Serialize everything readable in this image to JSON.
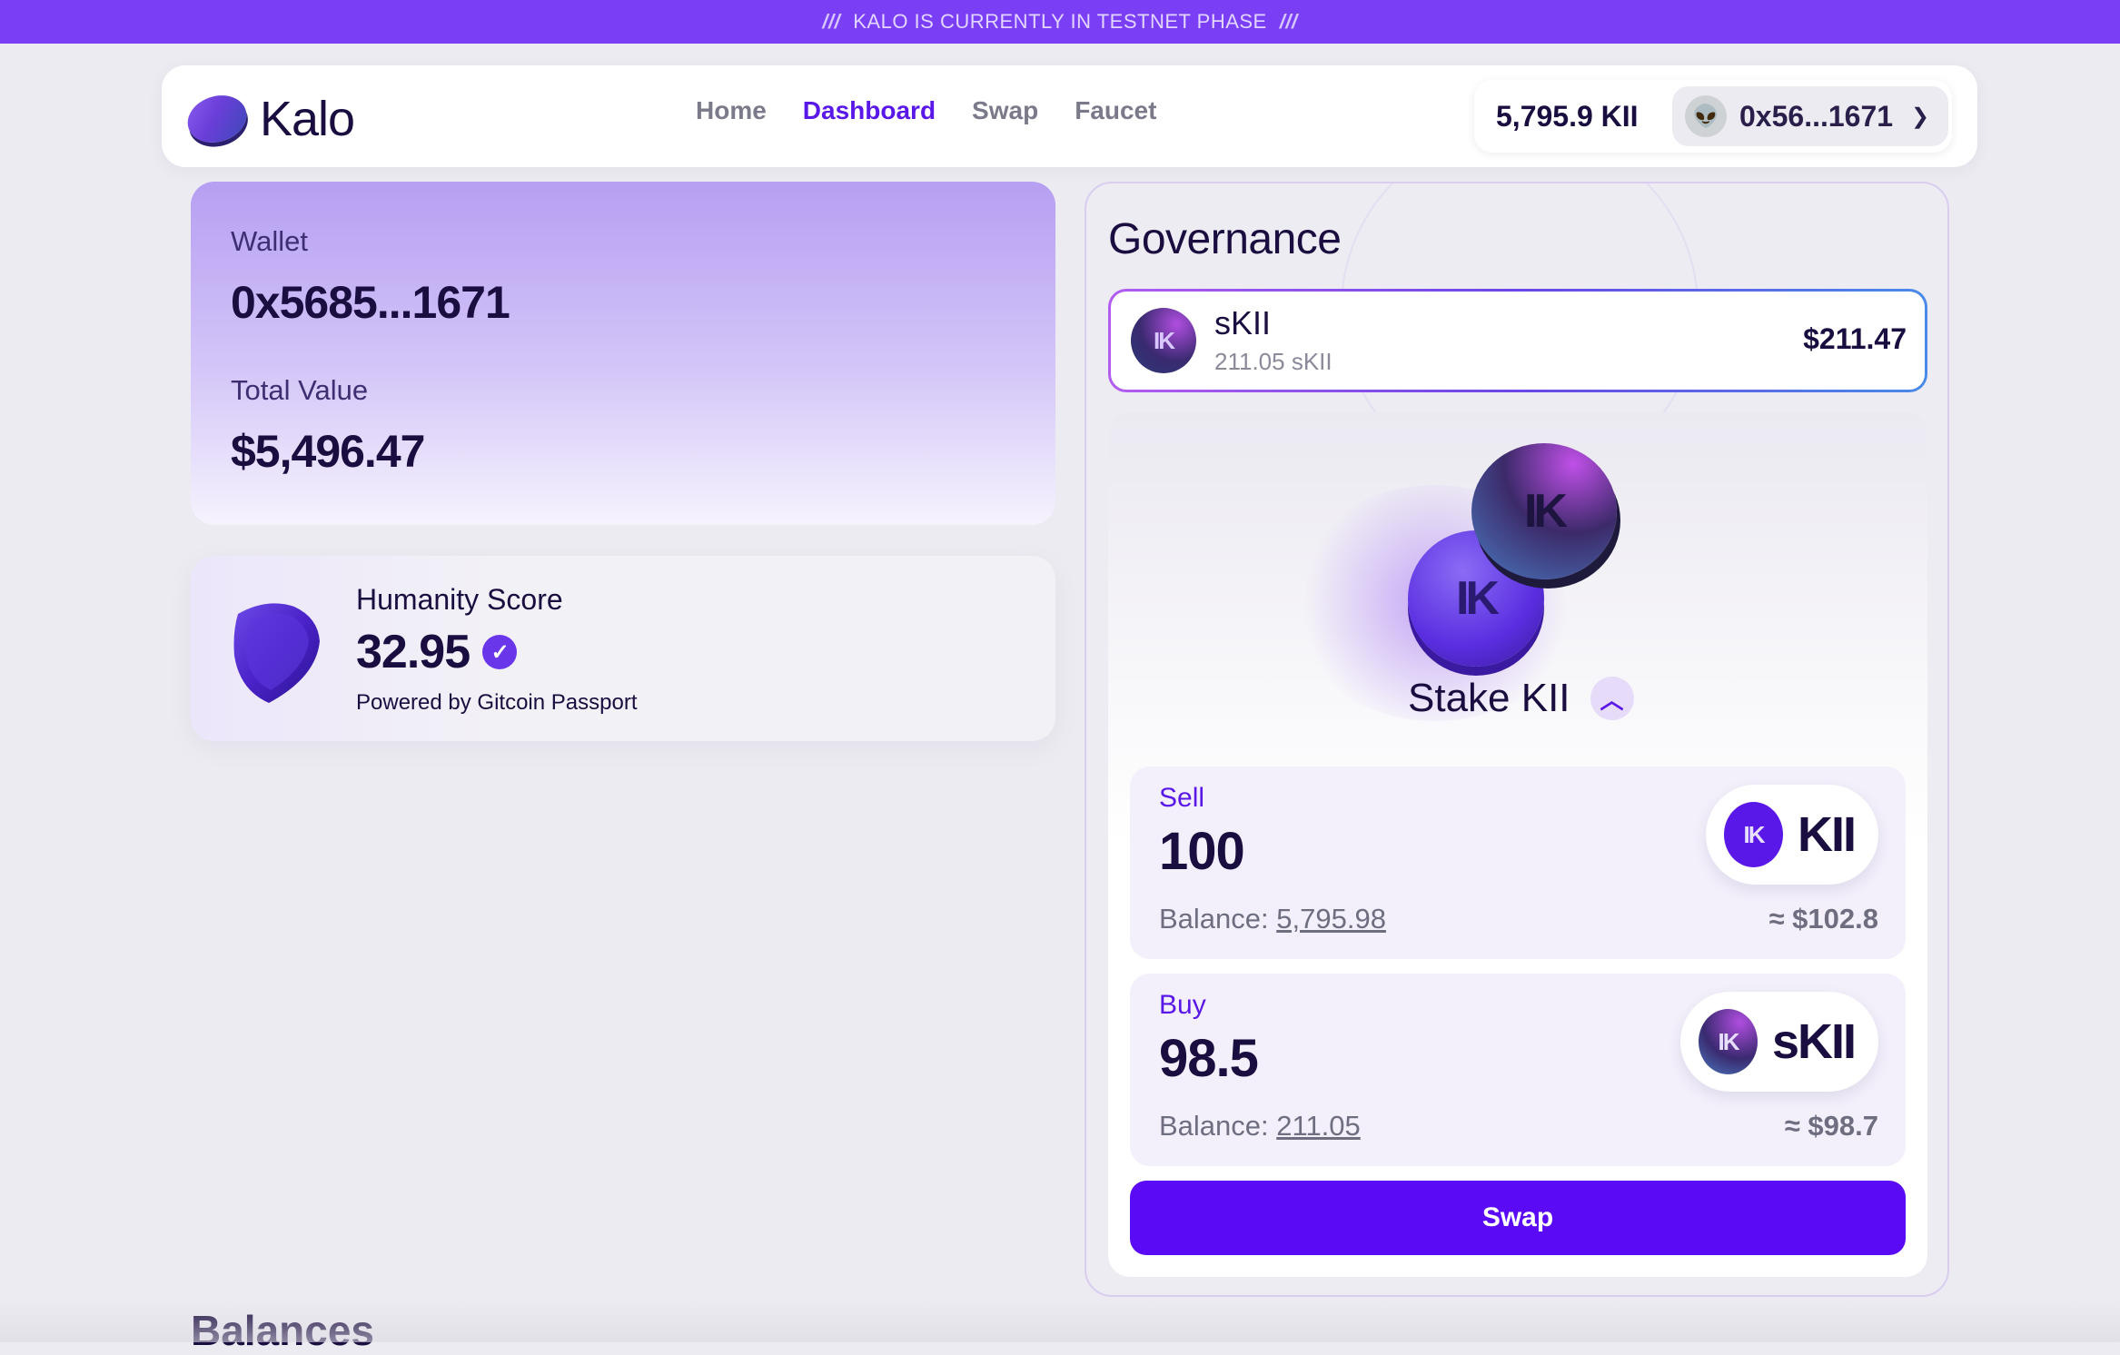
{
  "banner": {
    "text": "KALO IS CURRENTLY IN TESTNET PHASE",
    "marks": "///"
  },
  "header": {
    "logo_text": "Kalo",
    "nav": [
      {
        "label": "Home",
        "active": false
      },
      {
        "label": "Dashboard",
        "active": true
      },
      {
        "label": "Swap",
        "active": false
      },
      {
        "label": "Faucet",
        "active": false
      }
    ],
    "account": {
      "balance": "5,795.9 KII",
      "address": "0x56...1671"
    }
  },
  "wallet": {
    "wallet_label": "Wallet",
    "wallet_address": "0x5685...1671",
    "total_label": "Total Value",
    "total_value": "$5,496.47"
  },
  "humanity": {
    "title": "Humanity Score",
    "score": "32.95",
    "powered_by": "Powered by Gitcoin Passport"
  },
  "governance": {
    "title": "Governance",
    "token": {
      "name": "sKII",
      "amount": "211.05 sKII",
      "usd": "$211.47"
    },
    "stake_label": "Stake KII",
    "sell": {
      "label": "Sell",
      "amount": "100",
      "balance_prefix": "Balance:",
      "balance": "5,795.98",
      "usd": "≈ $102.8",
      "token": "KII"
    },
    "buy": {
      "label": "Buy",
      "amount": "98.5",
      "balance_prefix": "Balance:",
      "balance": "211.05",
      "usd": "≈ $98.7",
      "token": "sKII"
    },
    "swap_label": "Swap"
  },
  "balances_title": "Balances",
  "colors": {
    "brand": "#5a0af5",
    "banner": "#7a3ef5",
    "nav_active": "#5a18e8"
  }
}
